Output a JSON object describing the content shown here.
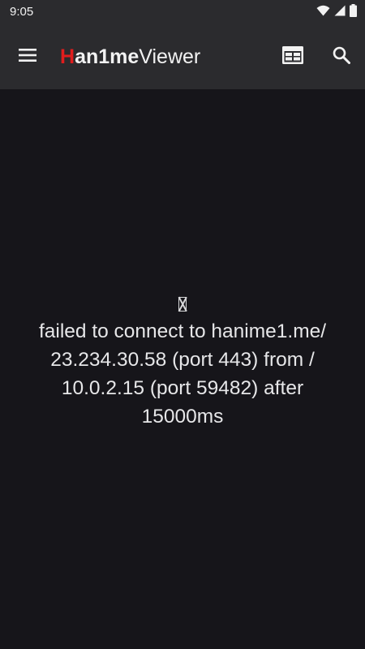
{
  "status_bar": {
    "time": "9:05",
    "icons": [
      "wifi-icon",
      "cellular-signal-icon",
      "battery-icon"
    ]
  },
  "toolbar": {
    "title_accent": "H",
    "title_bold": "an1me",
    "title_rest": "Viewer",
    "accent_color": "#e01d1d",
    "icons": {
      "menu": "menu-icon",
      "calendar": "calendar-icon",
      "search": "search-icon"
    }
  },
  "error": {
    "glyph": "missing-glyph-icon",
    "message": "failed to connect to hanime1.me/\n23.234.30.58 (port 443) from /\n10.0.2.15 (port 59482) after\n15000ms"
  }
}
